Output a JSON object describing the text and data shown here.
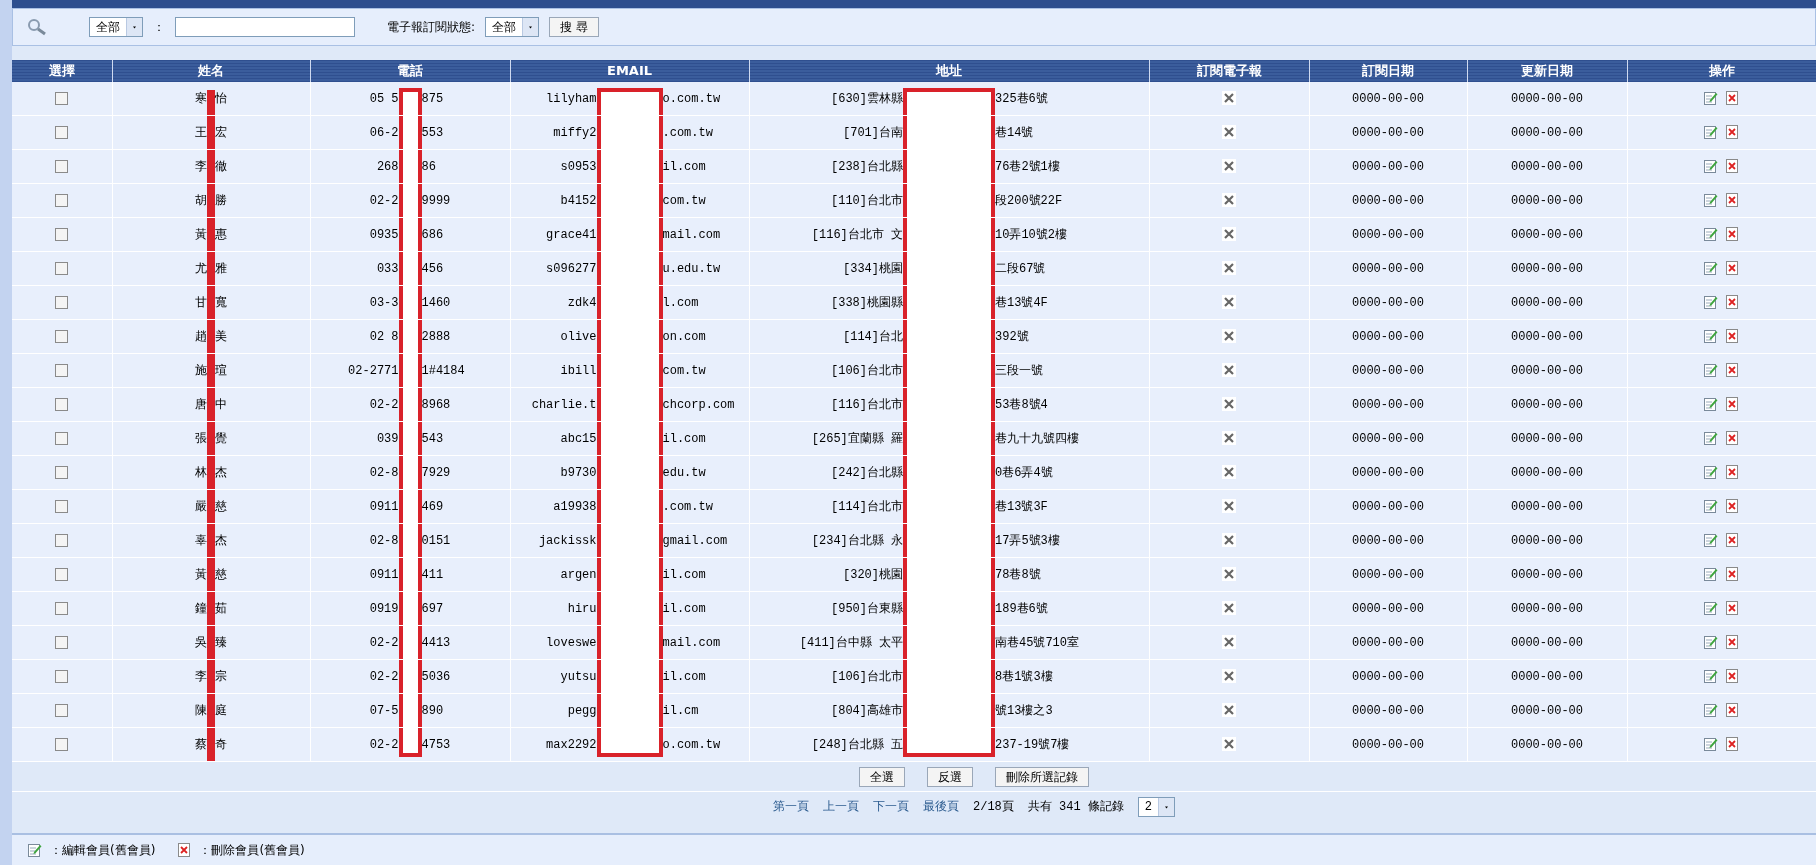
{
  "search": {
    "field_select": "全部",
    "separator": "：",
    "status_label": "電子報訂閱狀態:",
    "status_select": "全部",
    "button": "搜 尋"
  },
  "table": {
    "columns": [
      "選擇",
      "姓名",
      "電話",
      "EMAIL",
      "地址",
      "訂閱電子報",
      "訂閱日期",
      "更新日期",
      "操作"
    ],
    "rows": [
      {
        "selected": false,
        "name": [
          "寒",
          "怡"
        ],
        "phone": [
          "05 5",
          "875"
        ],
        "email": [
          "lilyham",
          "o.com.tw"
        ],
        "address": [
          "[630]雲林縣",
          "325巷6號"
        ],
        "subscribed": false,
        "subscribe_date": "0000-00-00",
        "update_date": "0000-00-00"
      },
      {
        "selected": false,
        "name": [
          "王",
          "宏"
        ],
        "phone": [
          "06-2",
          "553"
        ],
        "email": [
          "miffy2",
          ".com.tw"
        ],
        "address": [
          "[701]台南",
          "巷14號"
        ],
        "subscribed": false,
        "subscribe_date": "0000-00-00",
        "update_date": "0000-00-00"
      },
      {
        "selected": false,
        "name": [
          "李",
          "徹"
        ],
        "phone": [
          "268",
          "86"
        ],
        "email": [
          "s0953",
          "il.com"
        ],
        "address": [
          "[238]台北縣",
          "76巷2號1樓"
        ],
        "subscribed": false,
        "subscribe_date": "0000-00-00",
        "update_date": "0000-00-00"
      },
      {
        "selected": false,
        "name": [
          "胡",
          "勝"
        ],
        "phone": [
          "02-2",
          "9999"
        ],
        "email": [
          "b4152",
          "com.tw"
        ],
        "address": [
          "[110]台北市",
          "段200號22F"
        ],
        "subscribed": false,
        "subscribe_date": "0000-00-00",
        "update_date": "0000-00-00"
      },
      {
        "selected": false,
        "name": [
          "黃",
          "惠"
        ],
        "phone": [
          "0935",
          "686"
        ],
        "email": [
          "grace41",
          "mail.com"
        ],
        "address": [
          "[116]台北市 文",
          "10弄10號2樓"
        ],
        "subscribed": false,
        "subscribe_date": "0000-00-00",
        "update_date": "0000-00-00"
      },
      {
        "selected": false,
        "name": [
          "尤",
          "雅"
        ],
        "phone": [
          "033",
          "456"
        ],
        "email": [
          "s096277",
          "u.edu.tw"
        ],
        "address": [
          "[334]桃園",
          "二段67號"
        ],
        "subscribed": false,
        "subscribe_date": "0000-00-00",
        "update_date": "0000-00-00"
      },
      {
        "selected": false,
        "name": [
          "甘",
          "寬"
        ],
        "phone": [
          "03-3",
          "1460"
        ],
        "email": [
          "zdk4",
          "l.com"
        ],
        "address": [
          "[338]桃園縣",
          "巷13號4F"
        ],
        "subscribed": false,
        "subscribe_date": "0000-00-00",
        "update_date": "0000-00-00"
      },
      {
        "selected": false,
        "name": [
          "趙",
          "美"
        ],
        "phone": [
          "02 8",
          "2888"
        ],
        "email": [
          "olive",
          "on.com"
        ],
        "address": [
          "[114]台北",
          "392號"
        ],
        "subscribed": false,
        "subscribe_date": "0000-00-00",
        "update_date": "0000-00-00"
      },
      {
        "selected": false,
        "name": [
          "施",
          "瑄"
        ],
        "phone": [
          "02-2771",
          "1#4184"
        ],
        "email": [
          "ibill",
          "com.tw"
        ],
        "address": [
          "[106]台北市",
          "三段一號"
        ],
        "subscribed": false,
        "subscribe_date": "0000-00-00",
        "update_date": "0000-00-00"
      },
      {
        "selected": false,
        "name": [
          "唐",
          "中"
        ],
        "phone": [
          "02-2",
          "8968"
        ],
        "email": [
          "charlie.t",
          "chcorp.com"
        ],
        "address": [
          "[116]台北市",
          "53巷8號4"
        ],
        "subscribed": false,
        "subscribe_date": "0000-00-00",
        "update_date": "0000-00-00"
      },
      {
        "selected": false,
        "name": [
          "張",
          "覺"
        ],
        "phone": [
          "039",
          "543"
        ],
        "email": [
          "abc15",
          "il.com"
        ],
        "address": [
          "[265]宜蘭縣 羅",
          "巷九十九號四樓"
        ],
        "subscribed": false,
        "subscribe_date": "0000-00-00",
        "update_date": "0000-00-00"
      },
      {
        "selected": false,
        "name": [
          "林",
          "杰"
        ],
        "phone": [
          "02-8",
          "7929"
        ],
        "email": [
          "b9730",
          "edu.tw"
        ],
        "address": [
          "[242]台北縣",
          "0巷6弄4號"
        ],
        "subscribed": false,
        "subscribe_date": "0000-00-00",
        "update_date": "0000-00-00"
      },
      {
        "selected": false,
        "name": [
          "嚴",
          "慈"
        ],
        "phone": [
          "0911",
          "469"
        ],
        "email": [
          "a19938",
          ".com.tw"
        ],
        "address": [
          "[114]台北市",
          "巷13號3F"
        ],
        "subscribed": false,
        "subscribe_date": "0000-00-00",
        "update_date": "0000-00-00"
      },
      {
        "selected": false,
        "name": [
          "辜",
          "杰"
        ],
        "phone": [
          "02-8",
          "0151"
        ],
        "email": [
          "jackissk",
          "gmail.com"
        ],
        "address": [
          "[234]台北縣 永",
          "17弄5號3樓"
        ],
        "subscribed": false,
        "subscribe_date": "0000-00-00",
        "update_date": "0000-00-00"
      },
      {
        "selected": false,
        "name": [
          "黃",
          "慈"
        ],
        "phone": [
          "0911",
          "411"
        ],
        "email": [
          "argen",
          "il.com"
        ],
        "address": [
          "[320]桃園",
          "78巷8號"
        ],
        "subscribed": false,
        "subscribe_date": "0000-00-00",
        "update_date": "0000-00-00"
      },
      {
        "selected": false,
        "name": [
          "鐘",
          "茹"
        ],
        "phone": [
          "0919",
          "697"
        ],
        "email": [
          "hiru",
          "il.com"
        ],
        "address": [
          "[950]台東縣",
          "189巷6號"
        ],
        "subscribed": false,
        "subscribe_date": "0000-00-00",
        "update_date": "0000-00-00"
      },
      {
        "selected": false,
        "name": [
          "吳",
          "臻"
        ],
        "phone": [
          "02-2",
          "4413"
        ],
        "email": [
          "loveswe",
          "mail.com"
        ],
        "address": [
          "[411]台中縣 太平",
          "南巷45號710室"
        ],
        "subscribed": false,
        "subscribe_date": "0000-00-00",
        "update_date": "0000-00-00"
      },
      {
        "selected": false,
        "name": [
          "李",
          "宗"
        ],
        "phone": [
          "02-2",
          "5036"
        ],
        "email": [
          "yutsu",
          "il.com"
        ],
        "address": [
          "[106]台北市",
          "8巷1號3樓"
        ],
        "subscribed": false,
        "subscribe_date": "0000-00-00",
        "update_date": "0000-00-00"
      },
      {
        "selected": false,
        "name": [
          "陳",
          "庭"
        ],
        "phone": [
          "07-5",
          "890"
        ],
        "email": [
          "pegg",
          "il.cm"
        ],
        "address": [
          "[804]高雄市",
          "號13樓之3"
        ],
        "subscribed": false,
        "subscribe_date": "0000-00-00",
        "update_date": "0000-00-00"
      },
      {
        "selected": false,
        "name": [
          "蔡",
          "奇"
        ],
        "phone": [
          "02-2",
          "4753"
        ],
        "email": [
          "max2292",
          "o.com.tw"
        ],
        "address": [
          "[248]台北縣 五",
          "237-19號7樓"
        ],
        "subscribed": false,
        "subscribe_date": "0000-00-00",
        "update_date": "0000-00-00"
      }
    ]
  },
  "bulk_buttons": [
    "全選",
    "反選",
    "刪除所選記錄"
  ],
  "pagination": {
    "links": [
      "第一頁",
      "上一頁",
      "下一頁",
      "最後頁"
    ],
    "page_info": "2/18頁",
    "total": "共有 341 條記錄",
    "page_select": "2"
  },
  "legend": [
    {
      "kind": "edit",
      "label": "：編輯會員(舊會員)"
    },
    {
      "kind": "delete",
      "label": "：刪除會員(舊會員)"
    }
  ]
}
